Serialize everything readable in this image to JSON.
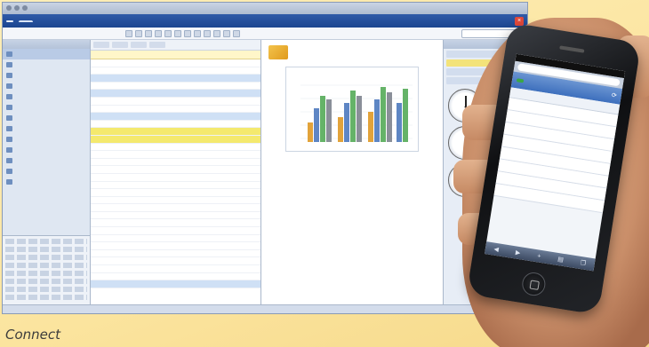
{
  "caption": "Connect",
  "app": {
    "window_title": "",
    "logo": "",
    "active_tab": "",
    "toolbar_label": ""
  },
  "left_nav": {
    "header": "",
    "folders": [
      "",
      "",
      "",
      "",
      "",
      "",
      "",
      "",
      "",
      "",
      "",
      "",
      ""
    ]
  },
  "message_list": {
    "infobar": "",
    "messages": [
      {
        "style": ""
      },
      {
        "style": ""
      },
      {
        "style": "blue"
      },
      {
        "style": ""
      },
      {
        "style": "blue"
      },
      {
        "style": ""
      },
      {
        "style": ""
      },
      {
        "style": "blue"
      },
      {
        "style": ""
      },
      {
        "style": "yellow"
      },
      {
        "style": "yellow"
      },
      {
        "style": ""
      },
      {
        "style": ""
      },
      {
        "style": ""
      },
      {
        "style": ""
      },
      {
        "style": ""
      },
      {
        "style": ""
      },
      {
        "style": ""
      },
      {
        "style": ""
      },
      {
        "style": ""
      },
      {
        "style": ""
      },
      {
        "style": ""
      },
      {
        "style": ""
      },
      {
        "style": ""
      },
      {
        "style": ""
      },
      {
        "style": ""
      },
      {
        "style": ""
      },
      {
        "style": ""
      },
      {
        "style": ""
      },
      {
        "style": "blue"
      }
    ]
  },
  "reader": {
    "chart_title": ""
  },
  "phone": {
    "green_button": "",
    "nav_title": "",
    "page_label": "",
    "rows": 8
  },
  "colors": {
    "background": "#fbe49e",
    "window_accent": "#1c4690",
    "highlight_yellow": "#f4e96e",
    "selection_blue": "#cfe0f5"
  }
}
